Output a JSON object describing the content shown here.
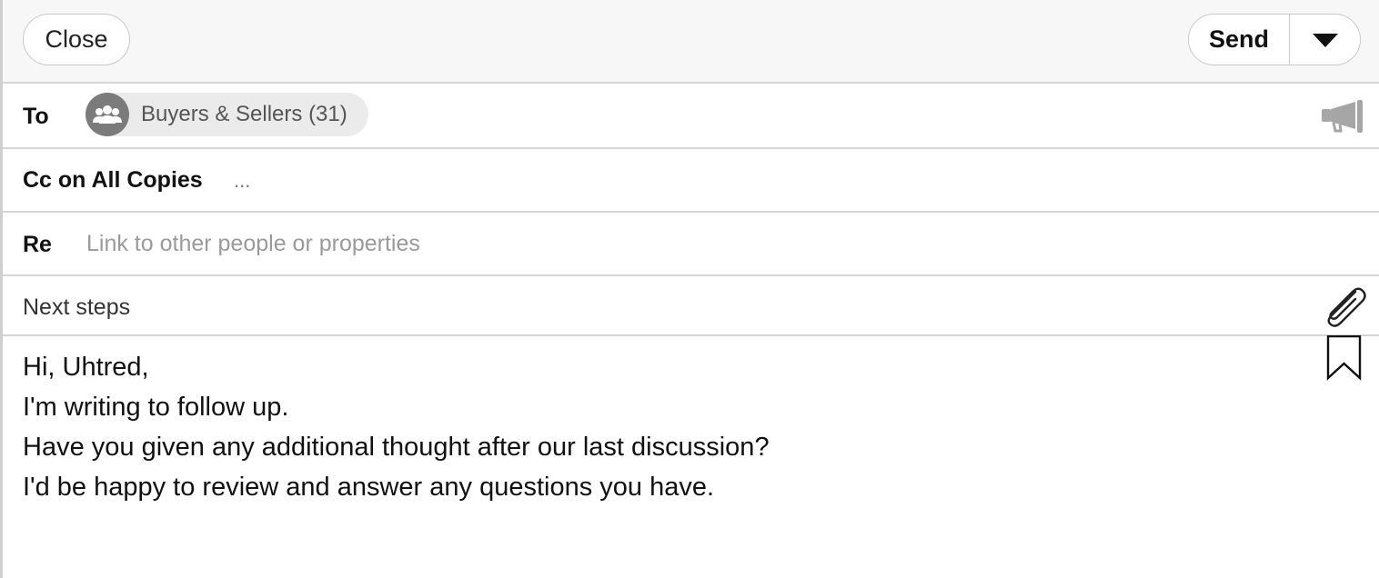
{
  "toolbar": {
    "close_label": "Close",
    "send_label": "Send"
  },
  "to": {
    "label": "To",
    "recipient": "Buyers & Sellers (31)"
  },
  "cc": {
    "label": "Cc on All Copies",
    "ellipsis": "..."
  },
  "re": {
    "label": "Re",
    "placeholder": "Link to other people or properties"
  },
  "subject": {
    "value": "Next steps"
  },
  "body": {
    "lines": [
      "Hi, Uhtred,",
      "",
      "I'm writing to follow up.",
      "",
      "Have you given any additional thought after our last discussion?",
      "I'd be happy to review and answer any questions you have."
    ]
  }
}
